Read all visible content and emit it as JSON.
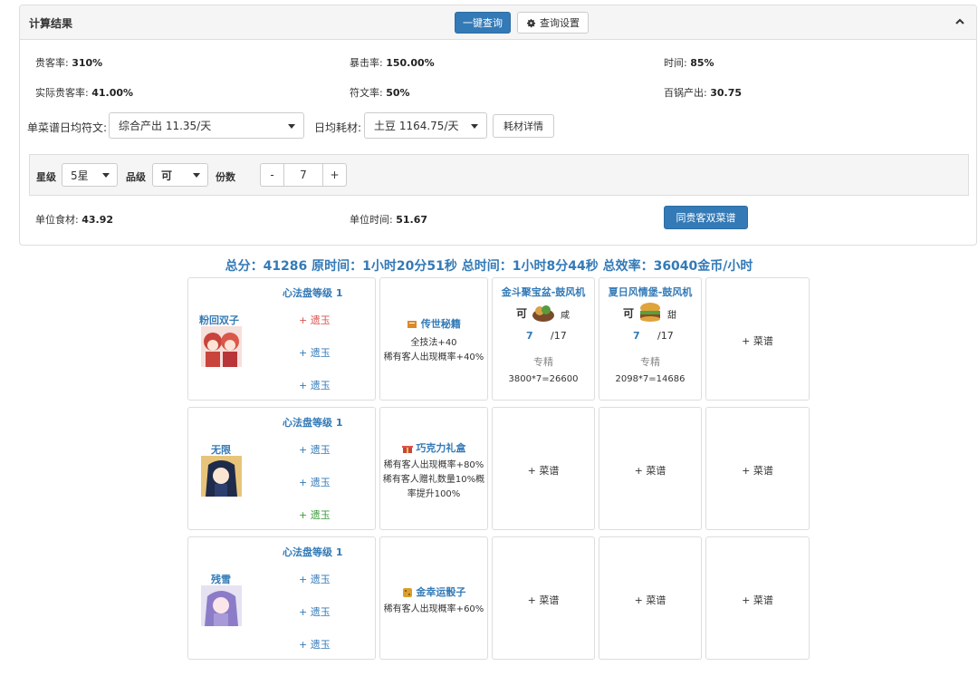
{
  "panel": {
    "title": "计算结果",
    "one_click_label": "一键查询",
    "settings_label": "查询设置"
  },
  "stats": {
    "row1": [
      {
        "label": "贵客率: ",
        "value": "310%"
      },
      {
        "label": "暴击率: ",
        "value": "150.00%"
      },
      {
        "label": "时间: ",
        "value": "85%"
      }
    ],
    "row2": [
      {
        "label": "实际贵客率: ",
        "value": "41.00%"
      },
      {
        "label": "符文率: ",
        "value": "50%"
      },
      {
        "label": "百锅产出: ",
        "value": "30.75"
      }
    ]
  },
  "selectors": {
    "rune_label": "单菜谱日均符文:",
    "rune_value": "综合产出 11.35/天",
    "consume_label": "日均耗材:",
    "consume_value": "土豆 1164.75/天",
    "detail_button": "耗材详情"
  },
  "filters": {
    "star_label": "星级",
    "star_value": "5星",
    "grade_label": "品级",
    "grade_value": "可",
    "count_label": "份数",
    "minus": "-",
    "count_value": "7",
    "plus": "+"
  },
  "unit": {
    "food_label": "单位食材: ",
    "food_value": "43.92",
    "time_label": "单位时间: ",
    "time_value": "51.67",
    "same_button": "同贵客双菜谱"
  },
  "summary": "总分：41286 原时间：1小时20分51秒 总时间：1小时8分44秒 总效率：36040金币/小时",
  "rows": [
    {
      "level": "心法盘等级 1",
      "chef": "粉回双子",
      "jades": [
        {
          "text": "+ 遗玉",
          "color": "#d9534f"
        },
        {
          "text": "+ 遗玉",
          "color": "#337ab7"
        },
        {
          "text": "+ 遗玉",
          "color": "#337ab7"
        }
      ],
      "equip_name": "传世秘籍",
      "equip_icon": "book-icon",
      "equip_lines": [
        "全技法+40",
        "稀有客人出现概率+40%"
      ],
      "recipes": [
        {
          "title": "金斗聚宝盆-鼓风机",
          "grade": "可",
          "taste": "咸",
          "count": "7",
          "total": "/17",
          "tag": "专精",
          "formula": "3800*7=26600"
        },
        {
          "title": "夏日风情堡-鼓风机",
          "grade": "可",
          "taste": "甜",
          "count": "7",
          "total": "/17",
          "tag": "专精",
          "formula": "2098*7=14686"
        },
        {
          "add": "+ 菜谱"
        }
      ]
    },
    {
      "level": "心法盘等级 1",
      "chef": "无限",
      "jades": [
        {
          "text": "+ 遗玉",
          "color": "#337ab7"
        },
        {
          "text": "+ 遗玉",
          "color": "#337ab7"
        },
        {
          "text": "+ 遗玉",
          "color": "#3c9a3c"
        }
      ],
      "equip_name": "巧克力礼盒",
      "equip_icon": "gift-box-icon",
      "equip_lines": [
        "稀有客人出现概率+80%",
        "稀有客人赠礼数量10%概",
        "率提升100%"
      ],
      "recipes": [
        {
          "add": "+ 菜谱"
        },
        {
          "add": "+ 菜谱"
        },
        {
          "add": "+ 菜谱"
        }
      ]
    },
    {
      "level": "心法盘等级 1",
      "chef": "残雪",
      "jades": [
        {
          "text": "+ 遗玉",
          "color": "#337ab7"
        },
        {
          "text": "+ 遗玉",
          "color": "#337ab7"
        },
        {
          "text": "+ 遗玉",
          "color": "#337ab7"
        }
      ],
      "equip_name": "金幸运骰子",
      "equip_icon": "dice-icon",
      "equip_lines": [
        "稀有客人出现概率+60%"
      ],
      "recipes": [
        {
          "add": "+ 菜谱"
        },
        {
          "add": "+ 菜谱"
        },
        {
          "add": "+ 菜谱"
        }
      ]
    }
  ],
  "colors": {
    "accent": "#337ab7",
    "red": "#d9534f",
    "green": "#3c9a3c"
  }
}
